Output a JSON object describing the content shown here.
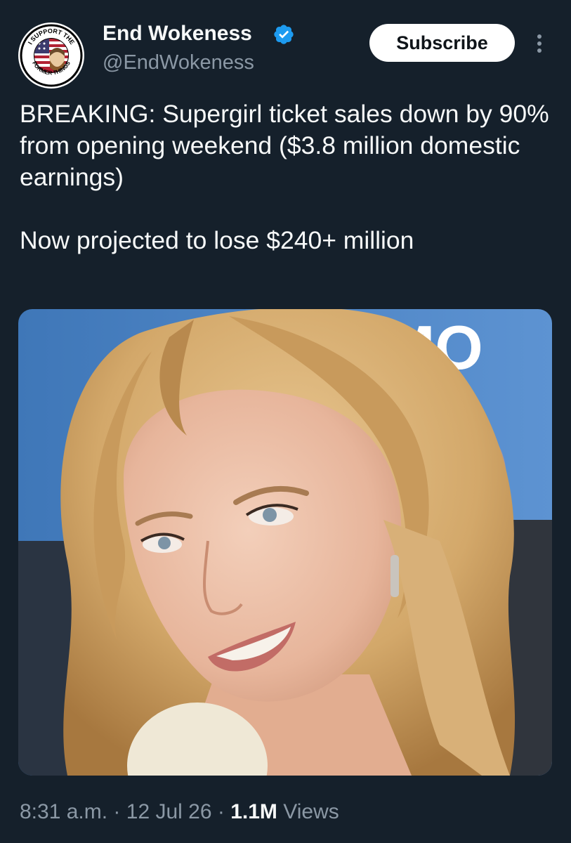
{
  "author": {
    "name": "End Wokeness",
    "handle": "@EndWokeness",
    "verified": true,
    "avatar_icon": "support-the-former-things-logo",
    "avatar_text_top": "I SUPPORT THE",
    "avatar_text_bottom": "FORMER THINGS"
  },
  "actions": {
    "subscribe_label": "Subscribe",
    "more_icon": "more-vertical-icon"
  },
  "tweet": {
    "line1": "BREAKING: Supergirl ticket sales down by 90% from opening weekend ($3.8 million domestic earnings)",
    "line2": "Now projected to lose $240+ million"
  },
  "media": {
    "kind": "photo",
    "backdrop_text": "MO"
  },
  "meta": {
    "time": "8:31 a.m.",
    "separator": "·",
    "date": "12 Jul 26",
    "views_count": "1.1M",
    "views_label": "Views"
  },
  "colors": {
    "background": "#15202b",
    "primary_text": "#f7f9f9",
    "secondary_text": "#8b98a5",
    "verified_blue": "#1d9bf0",
    "button_bg": "#ffffff"
  }
}
